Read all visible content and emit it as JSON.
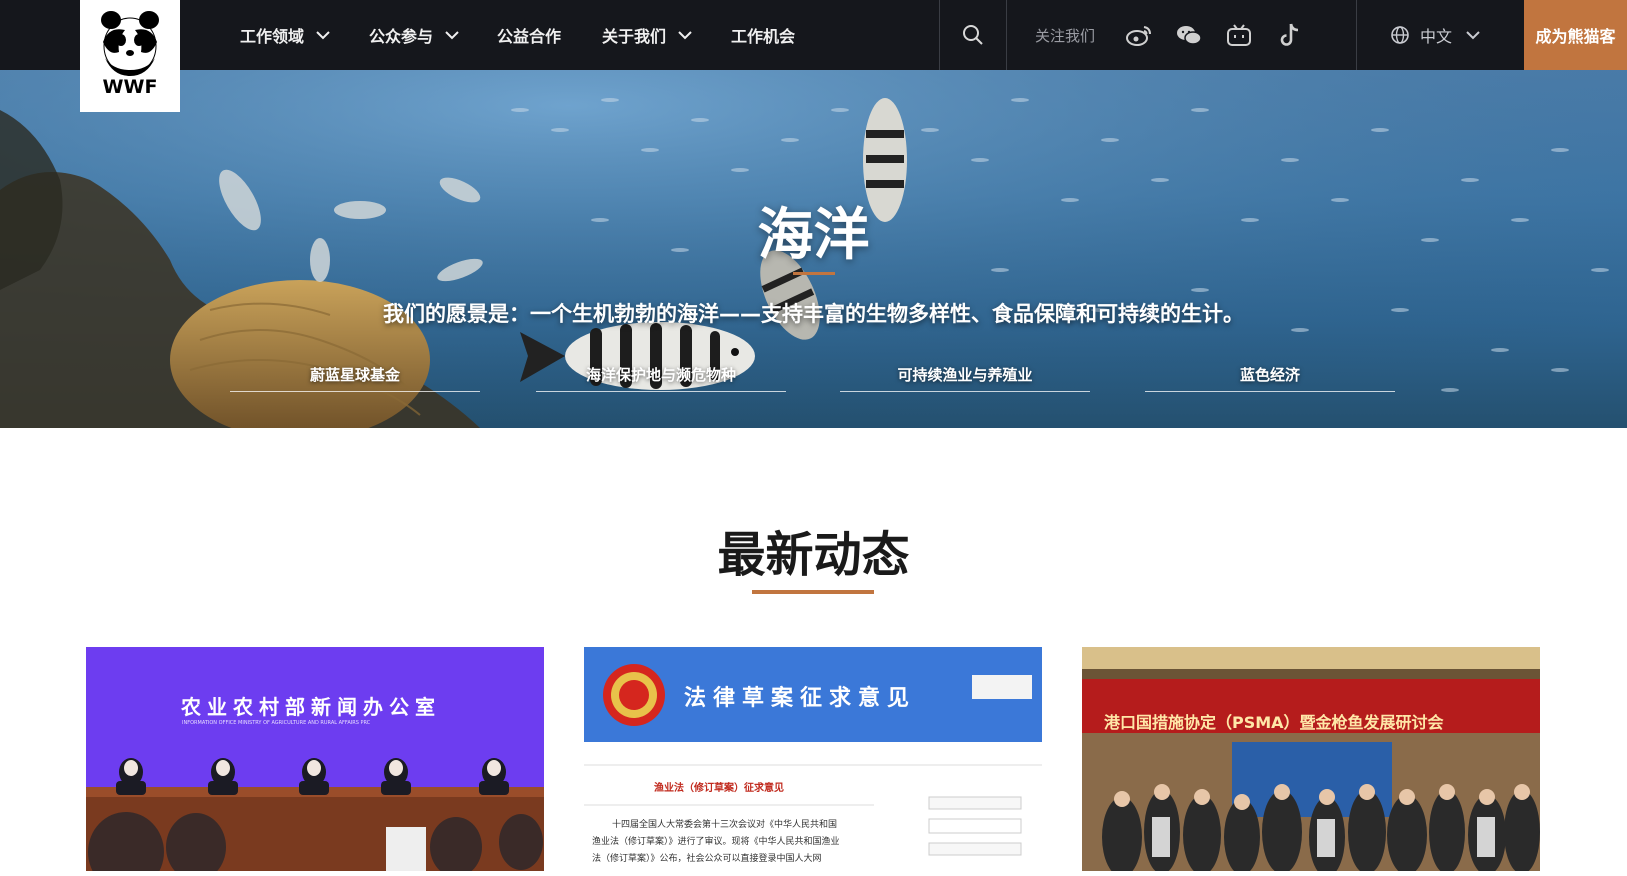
{
  "header": {
    "logo_text": "WWF",
    "nav": [
      {
        "label": "工作领域",
        "has_dropdown": true
      },
      {
        "label": "公众参与",
        "has_dropdown": true
      },
      {
        "label": "公益合作",
        "has_dropdown": false
      },
      {
        "label": "关于我们",
        "has_dropdown": true
      },
      {
        "label": "工作机会",
        "has_dropdown": false
      }
    ],
    "follow_label": "关注我们",
    "social_icons": [
      "weibo-icon",
      "wechat-icon",
      "bilibili-icon",
      "tiktok-icon"
    ],
    "language": "中文",
    "cta_label": "成为熊猫客"
  },
  "hero": {
    "title": "海洋",
    "subtitle": "我们的愿景是：一个生机勃勃的海洋——支持丰富的生物多样性、食品保障和可持续的生计。",
    "tabs": [
      "蔚蓝星球基金",
      "海洋保护地与濒危物种",
      "可持续渔业与养殖业",
      "蓝色经济"
    ]
  },
  "latest": {
    "title": "最新动态",
    "cards": [
      {
        "image_text": "农业农村部新闻办公室",
        "image_subtext": "INFORMATION OFFICE MINISTRY OF AGRICULTURE AND RURAL AFFAIRS PRC"
      },
      {
        "image_text": "法律草案征求意见",
        "image_heading": "渔业法（修订草案）征求意见",
        "image_body": [
          "十四届全国人大常委会第十三次会议对《中华人民共和国",
          "渔业法（修订草案）》进行了审议。现将《中华人民共和国渔业",
          "法（修订草案）》公布，社会公众可以直接登录中国人大网"
        ]
      },
      {
        "image_text": "港口国措施协定（PSMA）暨金枪鱼发展研讨会"
      }
    ]
  },
  "colors": {
    "accent": "#c1753f",
    "nav_bg": "#15171c",
    "card1_bg": "#6d3df0",
    "card2_banner": "#3b78d8",
    "card3_banner": "#b51c1c"
  }
}
